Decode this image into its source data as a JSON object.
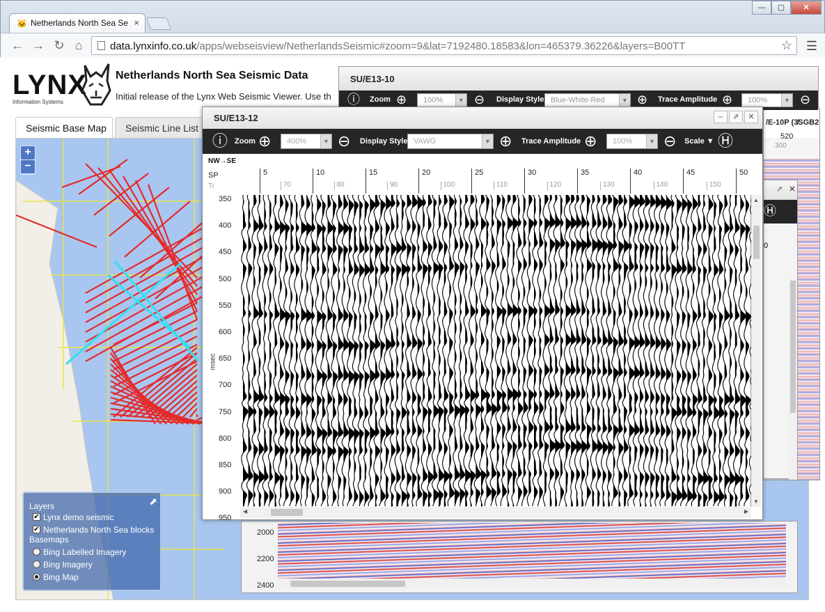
{
  "browser": {
    "tab_title": "Netherlands North Sea Se",
    "url_host": "data.lynxinfo.co.uk",
    "url_path": "/apps/webseisview/NetherlandsSeismic#zoom=9&lat=7192480.18583&lon=465379.36226&layers=B00TT"
  },
  "header": {
    "logo_text": "LYNX",
    "logo_sub": "Information Systems",
    "title": "Netherlands North Sea Seismic Data",
    "intro": "Initial release of the Lynx Web Seismic Viewer. Use th"
  },
  "tabs": [
    {
      "label": "Seismic Base Map",
      "active": true
    },
    {
      "label": "Seismic Line List",
      "active": false
    }
  ],
  "map": {
    "zoom_in": "+",
    "zoom_out": "−",
    "layers": {
      "title": "Layers",
      "overlays": [
        {
          "label": "Lynx demo seismic",
          "checked": true
        },
        {
          "label": "Netherlands North Sea blocks",
          "checked": true
        }
      ],
      "basemaps_title": "Basemaps",
      "basemaps": [
        {
          "label": "Bing Labelled Imagery",
          "selected": false
        },
        {
          "label": "Bing Imagery",
          "selected": false
        },
        {
          "label": "Bing Map",
          "selected": true
        }
      ]
    }
  },
  "panel_back": {
    "title": "SU/E13-10",
    "zoom_label": "Zoom",
    "zoom_value": "100%",
    "display_style_label": "Display Style",
    "display_style_value": "Blue-White-Red",
    "trace_amp_label": "Trace Amplitude",
    "trace_amp_value": "100%"
  },
  "panel_right": {
    "title": "/E-10P (3̸SGB2",
    "tick": "520",
    "tick2": "300",
    "row_label": "0"
  },
  "panel_bottom": {
    "y_ticks": [
      "2000",
      "2200",
      "2400"
    ]
  },
  "panel_front": {
    "title": "SU/E13-12",
    "zoom_label": "Zoom",
    "zoom_value": "400%",
    "display_style_label": "Display Style",
    "display_style_value": "VAWG",
    "trace_amp_label": "Trace Amplitude",
    "trace_amp_value": "100%",
    "scale_label": "Scale ▼",
    "direction": "NW→SE",
    "sp_label": "SP",
    "tr_label": "Tr",
    "y_unit": "msec",
    "sp_ticks": [
      "5",
      "10",
      "15",
      "20",
      "25",
      "30",
      "35",
      "40",
      "45",
      "50"
    ],
    "tr_ticks": [
      "70",
      "80",
      "90",
      "100",
      "110",
      "120",
      "130",
      "140",
      "150"
    ],
    "y_ticks": [
      "350",
      "400",
      "450",
      "500",
      "550",
      "600",
      "650",
      "700",
      "750",
      "800",
      "850",
      "900",
      "950"
    ]
  }
}
